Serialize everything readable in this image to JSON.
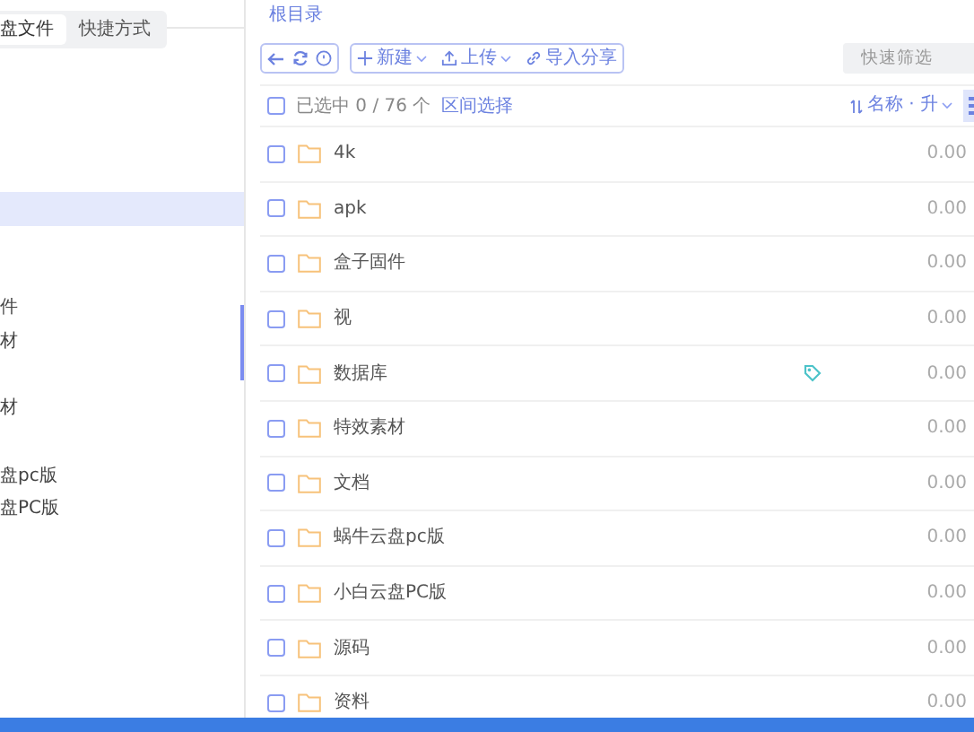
{
  "sidebar": {
    "tabs": [
      {
        "label": "盘文件",
        "selected": true
      },
      {
        "label": "快捷方式",
        "selected": false
      }
    ],
    "items": [
      {
        "selected": true
      },
      {
        "selected": false
      },
      {
        "selected": false
      },
      {
        "label": "件",
        "selected": false
      },
      {
        "label": "材",
        "selected": false
      },
      {
        "selected": false
      },
      {
        "label": "材",
        "selected": false
      },
      {
        "selected": false
      },
      {
        "label": "盘pc版",
        "selected": false
      },
      {
        "label": "盘PC版",
        "selected": false
      }
    ]
  },
  "breadcrumb": "根目录",
  "toolbar": {
    "actions": [
      {
        "label": "新建",
        "dropdown": true
      },
      {
        "label": "上传",
        "dropdown": true
      },
      {
        "label": "导入分享",
        "dropdown": false
      }
    ],
    "filter": {
      "placeholder": "快速筛选"
    }
  },
  "list_header": {
    "select_all_checked": false,
    "selection": "已选中 0 / 76 个",
    "range_select": "区间选择",
    "sort": "名称 · 升"
  },
  "files": [
    {
      "name": "4k",
      "size": "0.00",
      "checked": false,
      "tagged": false
    },
    {
      "name": "apk",
      "size": "0.00",
      "checked": false,
      "tagged": false
    },
    {
      "name": "盒子固件",
      "size": "0.00",
      "checked": false,
      "tagged": false
    },
    {
      "name": "视",
      "size": "0.00",
      "checked": false,
      "tagged": false
    },
    {
      "name": "数据库",
      "size": "0.00",
      "checked": false,
      "tagged": true
    },
    {
      "name": "特效素材",
      "size": "0.00",
      "checked": false,
      "tagged": false
    },
    {
      "name": "文档",
      "size": "0.00",
      "checked": false,
      "tagged": false
    },
    {
      "name": "蜗牛云盘pc版",
      "size": "0.00",
      "checked": false,
      "tagged": false
    },
    {
      "name": "小白云盘PC版",
      "size": "0.00",
      "checked": false,
      "tagged": false
    },
    {
      "name": "源码",
      "size": "0.00",
      "checked": false,
      "tagged": false
    },
    {
      "name": "资料",
      "size": "0.00",
      "checked": false,
      "tagged": false
    }
  ]
}
